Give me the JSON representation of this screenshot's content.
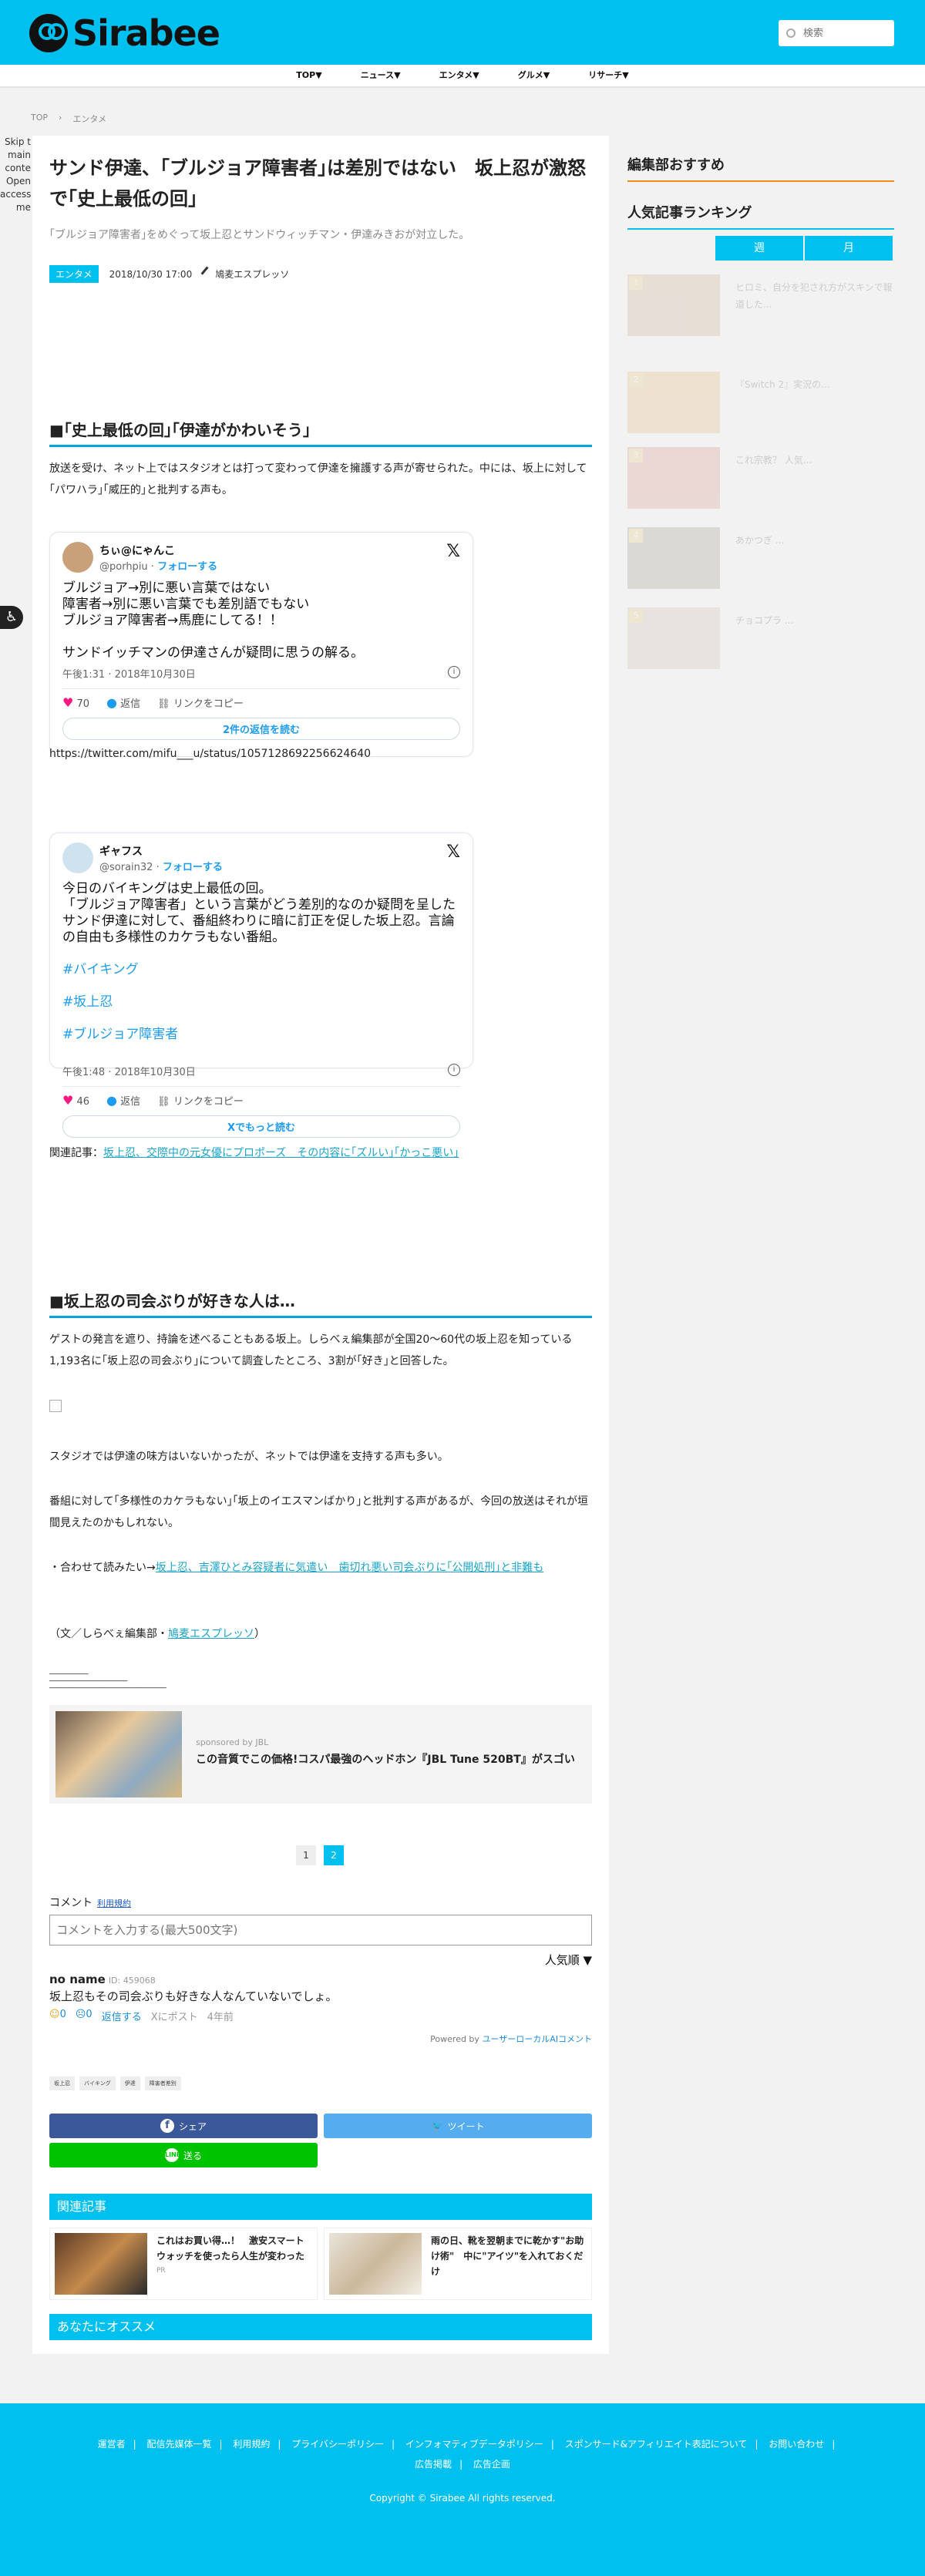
{
  "header": {
    "logo_text": "Sirabee",
    "search_placeholder": "検索"
  },
  "nav": [
    "TOP▼",
    "ニュース▼",
    "エンタメ▼",
    "グルメ▼",
    "リサーチ▼"
  ],
  "breadcrumb": [
    "TOP",
    "エンタメ"
  ],
  "skip_links": "Skip t main conte Open accessi me",
  "article": {
    "title": "サンド伊達、｢ブルジョア障害者｣は差別ではない　坂上忍が激怒で｢史上最低の回｣",
    "lead": "｢ブルジョア障害者｣をめぐって坂上忍とサンドウィッチマン・伊達みきおが対立した。",
    "category": "エンタメ",
    "date": "2018/10/30 17:00",
    "author": "鳩麦エスプレッソ",
    "section1_heading": "■｢史上最低の回｣｢伊達がかわいそう｣",
    "section1_para": "放送を受け、ネット上ではスタジオとは打って変わって伊達を擁護する声が寄せられた。中には、坂上に対して｢パワハラ｣｢威圧的｣と批判する声も。",
    "tweet_url": "https://twitter.com/mifu___u/status/1057128692256624640",
    "related_prefix": "関連記事：",
    "related_link": "坂上忍、交際中の元女優にプロポーズ　その内容に｢ズルい｣｢かっこ悪い｣",
    "section2_heading": "■坂上忍の司会ぶりが好きな人は…",
    "section2_para": "ゲストの発言を遮り、持論を述べることもある坂上。しらべぇ編集部が全国20〜60代の坂上忍を知っている1,193名に｢坂上忍の司会ぶり｣について調査したところ、3割が｢好き｣と回答した。",
    "para3": "スタジオでは伊達の味方はいないかったが、ネットでは伊達を支持する声も多い。",
    "para4": "番組に対して｢多様性のカケラもない｣｢坂上のイエスマンばかり｣と批判する声があるが、今回の放送はそれが垣間見えたのかもしれない。",
    "also_prefix": "・合わせて読みたい→",
    "also_link": "坂上忍、吉澤ひとみ容疑者に気遣い　歯切れ悪い司会ぶりに｢公開処刑｣と非難も",
    "credit_prefix": "（文／しらべぇ編集部・",
    "credit_link": "鳩麦エスプレッソ",
    "credit_suffix": "）"
  },
  "tweets": [
    {
      "name": "ちぃ@にゃんこ",
      "handle": "@porhpiu",
      "follow": "フォローする",
      "text": "ブルジョア→別に悪い言葉ではない\n障害者→別に悪い言葉でも差別語でもない\nブルジョア障害者→馬鹿にしてる！！\n\nサンドイッチマンの伊達さんが疑問に思うの解る。",
      "time": "午後1:31 · 2018年10月30日",
      "likes": "70",
      "reply": "返信",
      "copy": "リンクをコピー",
      "more": "2件の返信を読む"
    },
    {
      "name": "ギャフス",
      "handle": "@sorain32",
      "follow": "フォローする",
      "text": "今日のバイキングは史上最低の回。\n「ブルジョア障害者」という言葉がどう差別的なのか疑問を呈したサンド伊達に対して、番組終わりに暗に訂正を促した坂上忍。言論の自由も多様性のカケラもない番組。",
      "tags": [
        "#バイキング",
        "#坂上忍",
        "#ブルジョア障害者"
      ],
      "time": "午後1:48 · 2018年10月30日",
      "likes": "46",
      "reply": "返信",
      "copy": "リンクをコピー",
      "more": "Xでもっと読む"
    }
  ],
  "promo": {
    "sponsor": "sponsored by JBL",
    "title": "この音質でこの価格!コスパ最強のヘッドホン『JBL Tune 520BT』がスゴい"
  },
  "pagination": [
    "1",
    "2"
  ],
  "comments": {
    "label": "コメント",
    "terms": "利用規約",
    "placeholder": "コメントを入力する(最大500文字)",
    "sort": "人気順 ▼",
    "name": "no name",
    "id": "ID: 459068",
    "body": "坂上忍もその司会ぶりも好きな人なんていないでしょ。",
    "good": "0",
    "bad": "0",
    "reply": "返信する",
    "post": "Xにポスト",
    "ago": "4年前",
    "powered_prefix": "Powered by",
    "powered_link": "ユーザーローカルAIコメント"
  },
  "tags": [
    "坂上忍",
    "バイキング",
    "伊達",
    "障害者差別"
  ],
  "share": {
    "facebook": "シェア",
    "twitter": "ツイート",
    "line": "送る"
  },
  "related": {
    "heading": "関連記事",
    "items": [
      {
        "title": "これはお買い得…！　激安スマートウォッチを使ったら人生が変わった",
        "sub": "PR"
      },
      {
        "title": "雨の日、靴を翌朝までに乾かす\"お助け術\"　中に\"アイツ\"を入れておくだけ",
        "sub": ""
      }
    ]
  },
  "recommend_heading": "あなたにオススメ",
  "sidebar": {
    "editor_pick": "編集部おすすめ",
    "ranking": "人気記事ランキング",
    "tabs": [
      "週",
      "月"
    ],
    "items": [
      {
        "num": "1",
        "title": "ヒロミ、自分を犯され方がスキンで報道した..."
      },
      {
        "num": "2",
        "title": "『Switch 2』実況の..."
      },
      {
        "num": "3",
        "title": "これ宗教？ 人気..."
      },
      {
        "num": "4",
        "title": "あかつぎ ..."
      },
      {
        "num": "5",
        "title": "チョコプラ ..."
      }
    ]
  },
  "footer": {
    "links": [
      "運営者",
      "配信先媒体一覧",
      "利用規約",
      "プライバシーポリシー",
      "インフォマティブデータポリシー",
      "スポンサード&アフィリエイト表記について",
      "お問い合わせ",
      "広告掲載",
      "広告企画"
    ],
    "copyright": "Copyright © Sirabee All rights reserved."
  },
  "colors": {
    "brand": "#00c0ef",
    "heading_line": "#00a9d9",
    "sidebar_accent": "#ef8d1b"
  }
}
